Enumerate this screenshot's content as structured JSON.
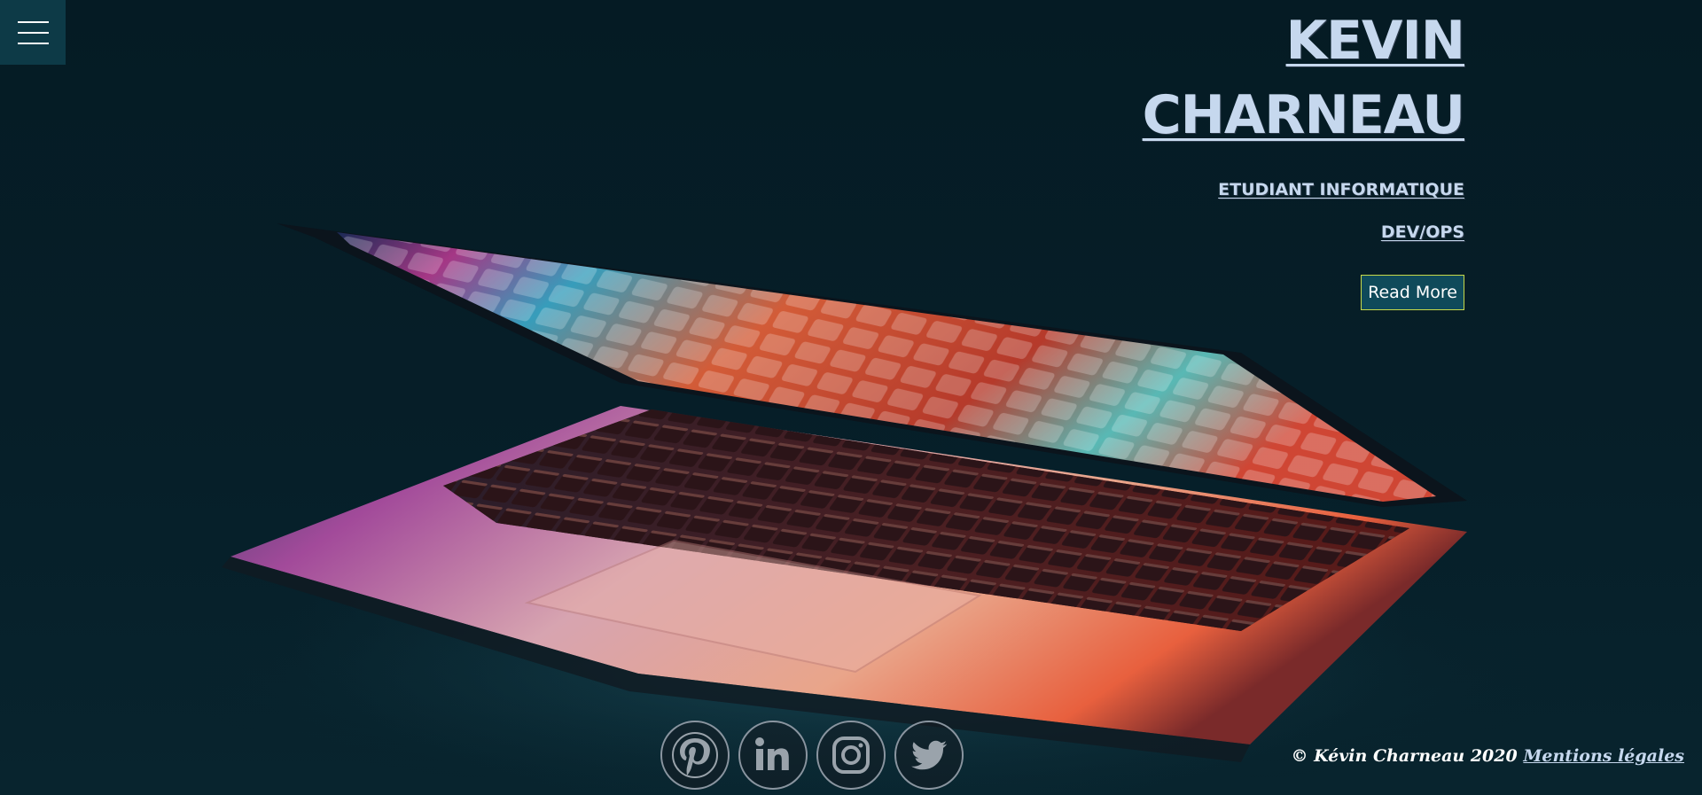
{
  "nav": {
    "menu_icon": "hamburger-menu-icon"
  },
  "hero": {
    "name_first": "KEVIN",
    "name_last": "CHARNEAU",
    "subtitle_1": "ETUDIANT INFORMATIQUE",
    "subtitle_2": "DEV/OPS",
    "read_more_label": "Read More",
    "background_image": "laptop-keyboard-glow"
  },
  "socials": [
    {
      "name": "Pinterest",
      "icon": "pinterest-icon"
    },
    {
      "name": "LinkedIn",
      "icon": "linkedin-icon"
    },
    {
      "name": "Instagram",
      "icon": "instagram-icon"
    },
    {
      "name": "Twitter",
      "icon": "twitter-icon"
    }
  ],
  "footer": {
    "copyright": "© Kévin Charneau 2020",
    "legal_link": "Mentions légales"
  },
  "colors": {
    "background": "#061d26",
    "menu_bg": "#0d3a47",
    "heading": "#c6d8ee",
    "button_bg": "#0f4a5a",
    "button_border": "#c7d94a"
  }
}
